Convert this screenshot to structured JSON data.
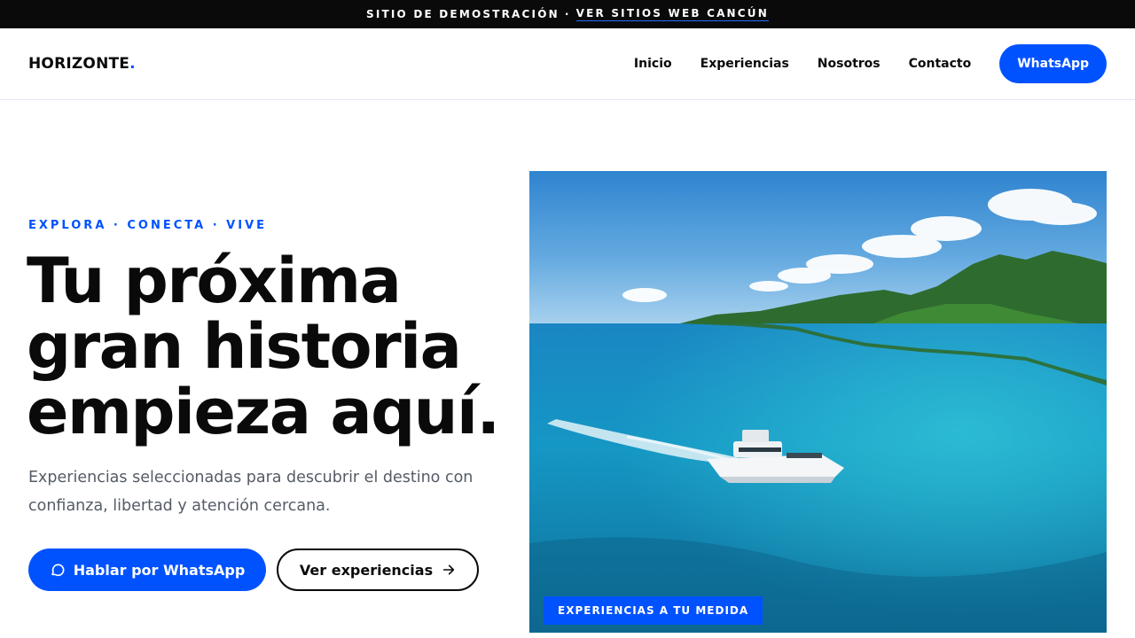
{
  "topbar": {
    "label": "SITIO DE DEMOSTRACIÓN",
    "separator": "·",
    "link": "VER SITIOS WEB CANCÚN"
  },
  "header": {
    "logo": "HORIZONTE",
    "logo_dot": ".",
    "nav": [
      "Inicio",
      "Experiencias",
      "Nosotros",
      "Contacto"
    ],
    "whatsapp_button": "WhatsApp"
  },
  "hero": {
    "eyebrow": "EXPLORA · CONECTA · VIVE",
    "title_lines": [
      "Tu próxima",
      "gran historia",
      "empieza aquí."
    ],
    "subtitle": "Experiencias seleccionadas para descubrir el destino con confianza, libertad y atención cercana.",
    "cta_primary": "Hablar por WhatsApp",
    "cta_primary_icon": "chat-bubble-icon",
    "cta_secondary": "Ver experiencias",
    "cta_secondary_icon": "arrow-right-icon",
    "image_badge": "EXPERIENCIAS A TU MEDIDA"
  },
  "colors": {
    "accent": "#0052ff",
    "topbar_bg": "#0a0a0a",
    "text": "#0a0a0a",
    "muted_text": "#555b66"
  }
}
